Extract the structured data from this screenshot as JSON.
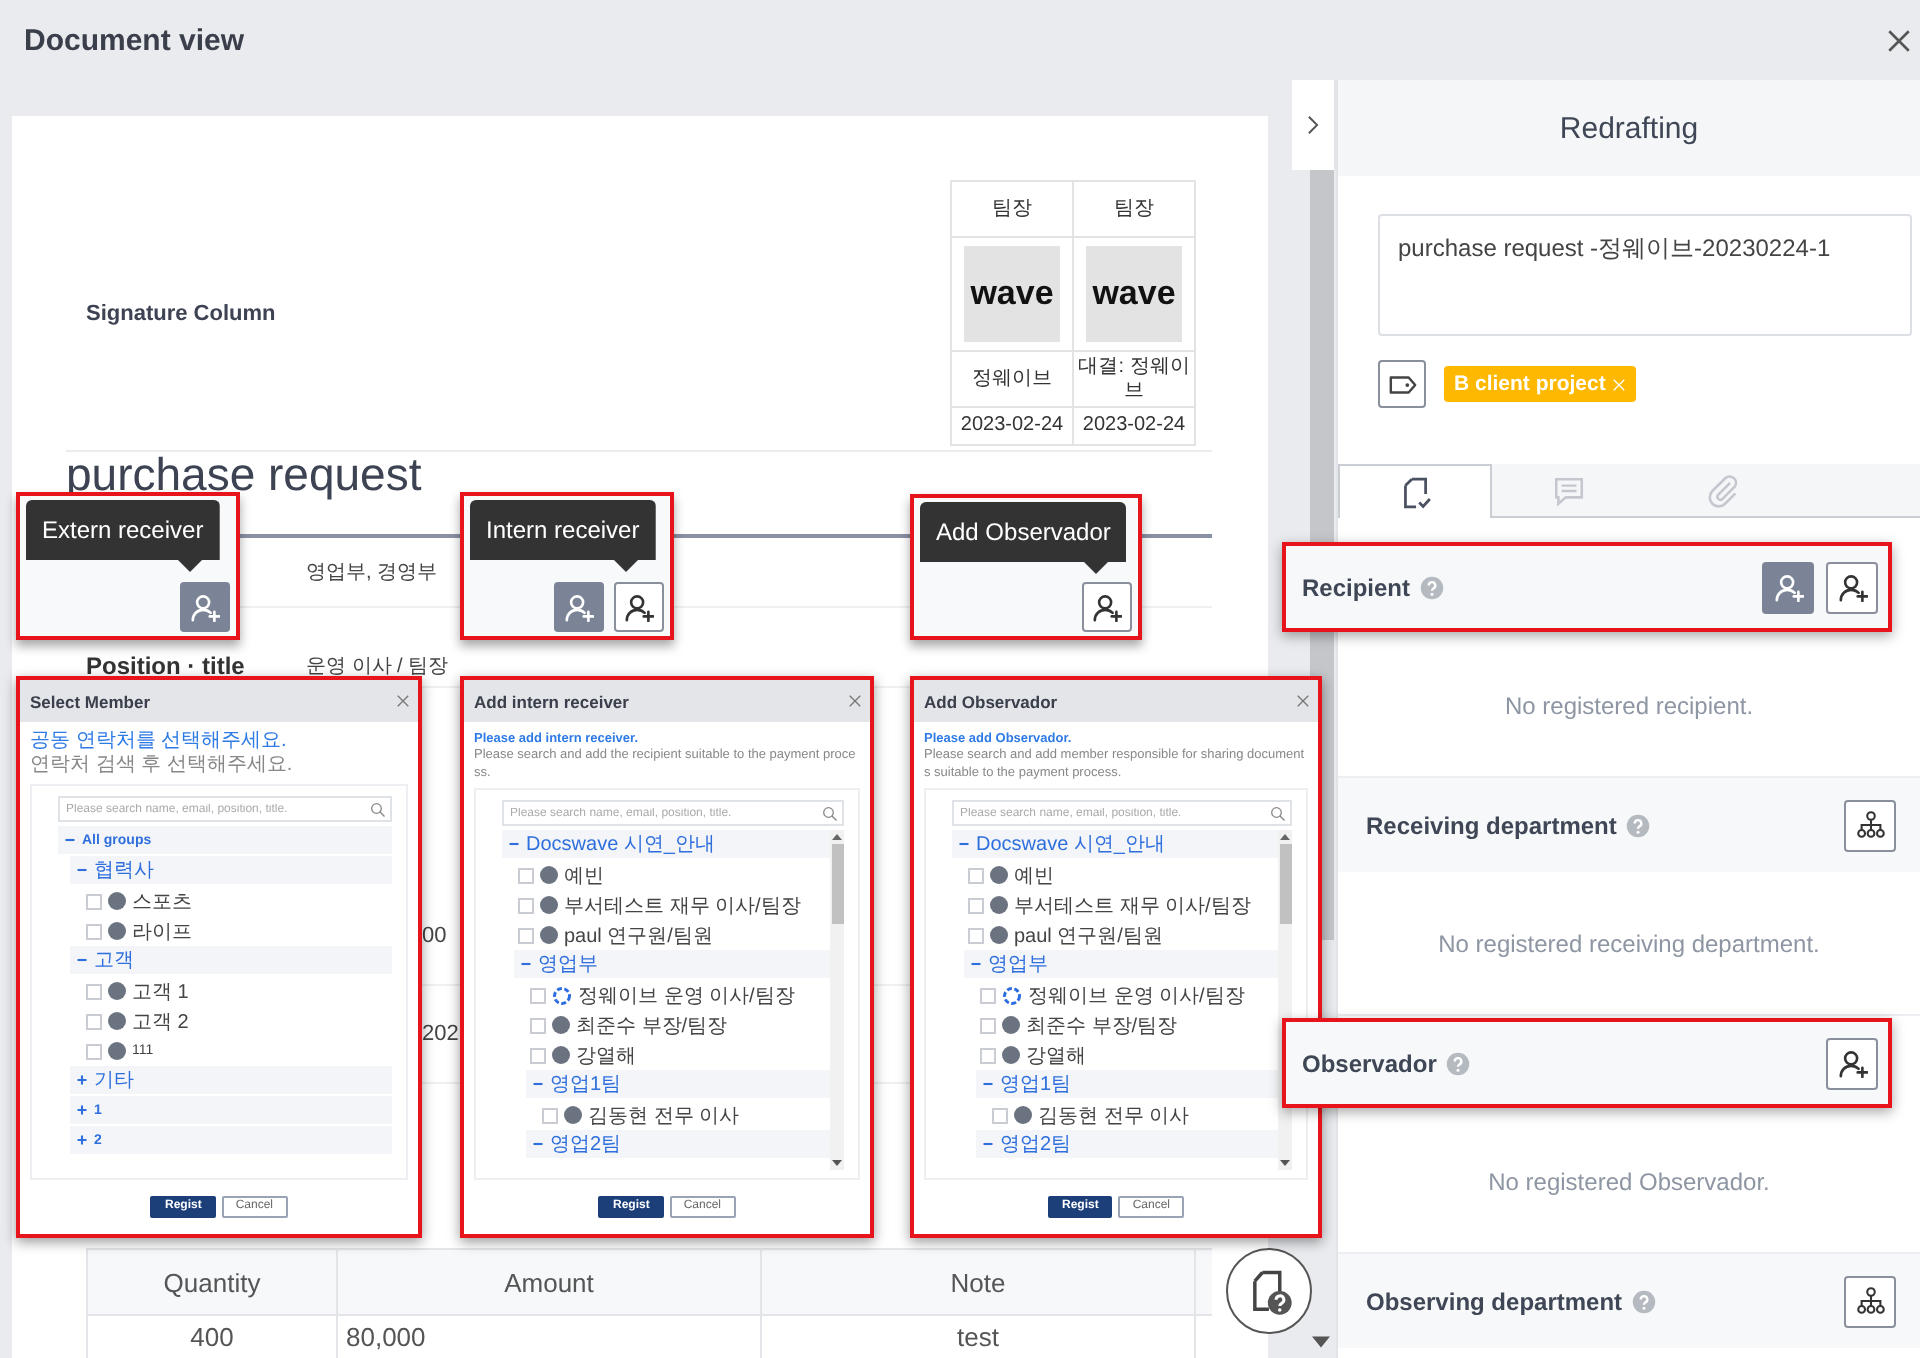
{
  "window": {
    "title": "Document view"
  },
  "document": {
    "signature_label": "Signature Column",
    "approvals": [
      {
        "role": "팀장",
        "stamp": "wave",
        "name": "정웨이브",
        "date": "2023-02-24"
      },
      {
        "role": "팀장",
        "stamp": "wave",
        "name": "대결: 정웨이브",
        "date": "2023-02-24"
      }
    ],
    "title": "purchase request",
    "fields": [
      {
        "value": "영업부, 경영부"
      },
      {
        "label": "Position · title",
        "value": "운영 이사 / 팀장"
      }
    ],
    "partial_cells": [
      "00",
      "202"
    ],
    "table": {
      "columns": [
        "Quantity",
        "Amount",
        "Note"
      ],
      "rows": [
        [
          "400",
          "80,000",
          "test"
        ]
      ]
    }
  },
  "callouts": [
    {
      "tooltip": "Extern receiver",
      "buttons": [
        {
          "kind": "filled"
        }
      ]
    },
    {
      "tooltip": "Intern receiver",
      "buttons": [
        {
          "kind": "filled"
        },
        {
          "kind": "outline"
        }
      ]
    },
    {
      "tooltip": "Add Observador",
      "buttons": [
        {
          "kind": "outline"
        }
      ]
    }
  ],
  "dialogs": [
    {
      "title": "Select Member",
      "intro": "공동 연락처를 선택해주세요.",
      "hint": "연락처 검색 후 선택해주세요.",
      "search_placeholder": "Please search name, email, position, title.",
      "scrollable": false,
      "tree": [
        {
          "kind": "group",
          "label": "All groups",
          "expanded": true,
          "children": [
            {
              "kind": "group",
              "label": "협력사",
              "expanded": true,
              "children": [
                {
                  "kind": "member",
                  "label": "스포츠",
                  "checked": false
                },
                {
                  "kind": "member",
                  "label": "라이프",
                  "checked": false
                }
              ]
            },
            {
              "kind": "group",
              "label": "고객",
              "expanded": true,
              "children": [
                {
                  "kind": "member",
                  "label": "고객 1",
                  "checked": false
                },
                {
                  "kind": "member",
                  "label": "고객 2",
                  "checked": false
                },
                {
                  "kind": "member",
                  "label": "111",
                  "checked": false
                }
              ]
            },
            {
              "kind": "group",
              "label": "기타",
              "expanded": false
            },
            {
              "kind": "group",
              "label": "1",
              "expanded": false
            },
            {
              "kind": "group",
              "label": "2",
              "expanded": false
            }
          ]
        }
      ],
      "buttons": [
        {
          "label": "Regist",
          "kind": "primary"
        },
        {
          "label": "Cancel",
          "kind": "secondary"
        }
      ]
    },
    {
      "title": "Add intern receiver",
      "intro": "Please add intern receiver.",
      "hint": "Please search and add the recipient suitable to the payment process.",
      "search_placeholder": "Please search name, email, position, title.",
      "scrollable": true,
      "tree": [
        {
          "kind": "group",
          "label": "Docswave 시연_안내",
          "expanded": true,
          "children": [
            {
              "kind": "member",
              "label": "예빈",
              "checked": false
            },
            {
              "kind": "member",
              "label": "부서테스트 재무 이사/팀장",
              "checked": false
            },
            {
              "kind": "member",
              "label": "paul 연구원/팀원",
              "checked": false
            },
            {
              "kind": "group",
              "label": "영업부",
              "expanded": true,
              "children": [
                {
                  "kind": "logo_member",
                  "label": "정웨이브 운영 이사/팀장",
                  "checked": false
                },
                {
                  "kind": "member",
                  "label": "최준수 부장/팀장",
                  "checked": false
                },
                {
                  "kind": "member",
                  "label": "강열해",
                  "checked": false
                },
                {
                  "kind": "group",
                  "label": "영업1팀",
                  "expanded": true,
                  "children": [
                    {
                      "kind": "member",
                      "label": "김동현 전무 이사",
                      "checked": false
                    }
                  ]
                },
                {
                  "kind": "group",
                  "label": "영업2팀",
                  "expanded": true
                }
              ]
            }
          ]
        }
      ],
      "buttons": [
        {
          "label": "Regist",
          "kind": "primary"
        },
        {
          "label": "Cancel",
          "kind": "secondary"
        }
      ]
    },
    {
      "title": "Add Observador",
      "intro": "Please add Observador.",
      "hint": "Please search and add member responsible for sharing documents suitable to the payment process.",
      "search_placeholder": "Please search name, email, position, title.",
      "scrollable": true,
      "tree": [
        {
          "kind": "group",
          "label": "Docswave 시연_안내",
          "expanded": true,
          "children": [
            {
              "kind": "member",
              "label": "예빈",
              "checked": false
            },
            {
              "kind": "member",
              "label": "부서테스트 재무 이사/팀장",
              "checked": false
            },
            {
              "kind": "member",
              "label": "paul 연구원/팀원",
              "checked": false
            },
            {
              "kind": "group",
              "label": "영업부",
              "expanded": true,
              "children": [
                {
                  "kind": "logo_member",
                  "label": "정웨이브 운영 이사/팀장",
                  "checked": false
                },
                {
                  "kind": "member",
                  "label": "최준수 부장/팀장",
                  "checked": false
                },
                {
                  "kind": "member",
                  "label": "강열해",
                  "checked": false
                },
                {
                  "kind": "group",
                  "label": "영업1팀",
                  "expanded": true,
                  "children": [
                    {
                      "kind": "member",
                      "label": "김동현 전무 이사",
                      "checked": false
                    }
                  ]
                },
                {
                  "kind": "group",
                  "label": "영업2팀",
                  "expanded": true
                }
              ]
            }
          ]
        }
      ],
      "buttons": [
        {
          "label": "Regist",
          "kind": "primary"
        },
        {
          "label": "Cancel",
          "kind": "secondary"
        }
      ]
    }
  ],
  "panel": {
    "title": "Redrafting",
    "subject": "purchase request -정웨이브-20230224-1",
    "tags": [
      {
        "label": "B client project"
      }
    ],
    "tabs": [
      {
        "kind": "approval",
        "selected": true
      },
      {
        "kind": "comments",
        "selected": false
      },
      {
        "kind": "attachments",
        "selected": false
      }
    ],
    "sections": [
      {
        "title": "Recipient",
        "highlighted": true,
        "buttons": [
          {
            "kind": "filled"
          },
          {
            "kind": "outline"
          }
        ],
        "empty_text": "No registered recipient."
      },
      {
        "title": "Receiving department",
        "highlighted": false,
        "buttons": [
          {
            "kind": "org"
          }
        ],
        "empty_text": "No registered receiving department."
      },
      {
        "title": "Observador",
        "highlighted": true,
        "buttons": [
          {
            "kind": "outline"
          }
        ],
        "empty_text": "No registered Observador."
      },
      {
        "title": "Observing department",
        "highlighted": false,
        "buttons": [
          {
            "kind": "org"
          }
        ]
      }
    ]
  }
}
